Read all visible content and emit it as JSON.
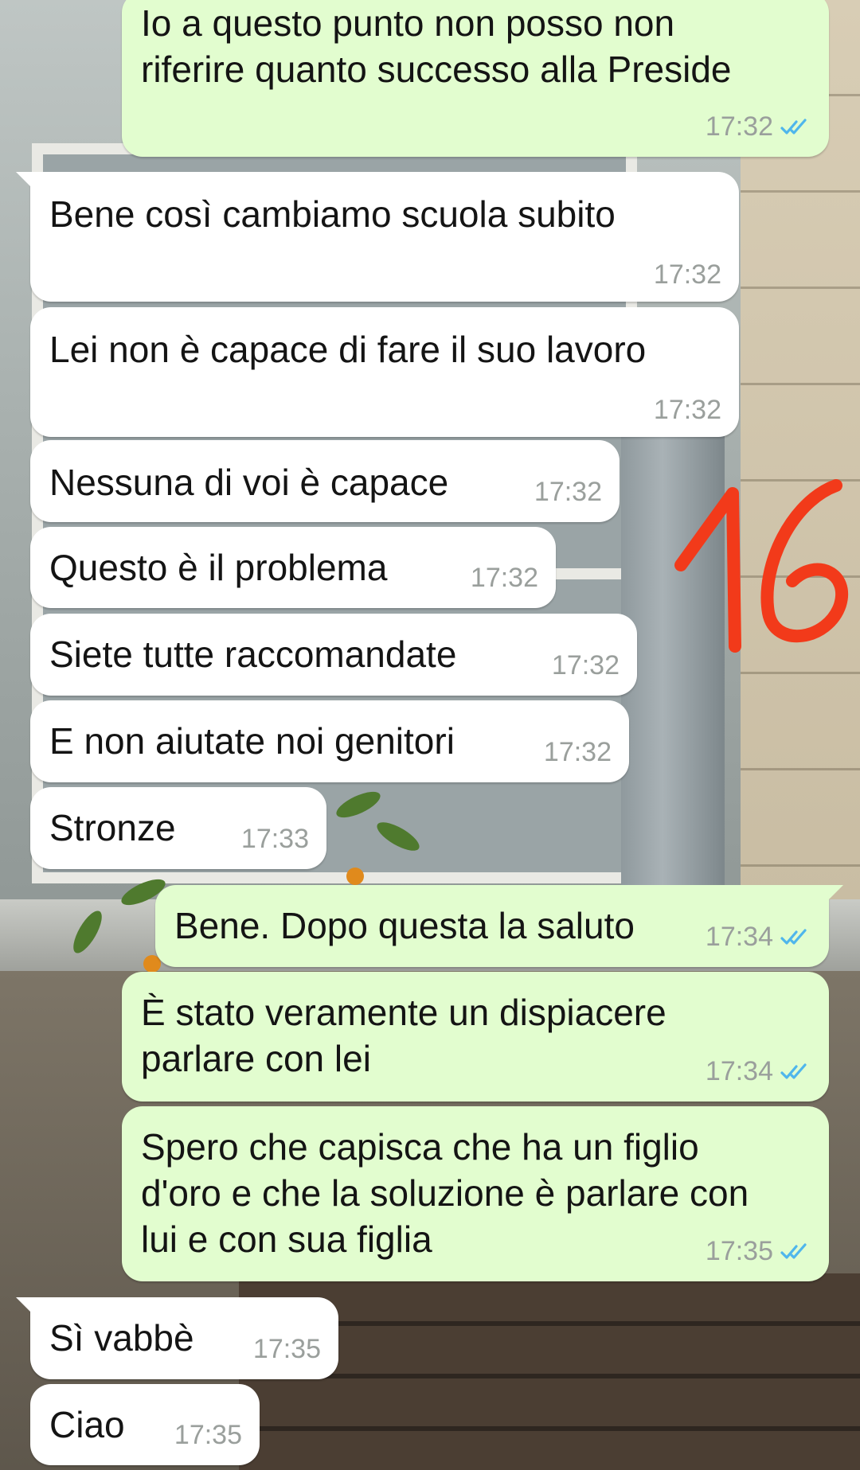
{
  "colors": {
    "incoming_bubble": "#ffffff",
    "outgoing_bubble": "#e2fdcf",
    "timestamp": "#9a9f9c",
    "read_ticks": "#4fb6ec",
    "annotation": "#f23a1a"
  },
  "annotation": {
    "text": "16"
  },
  "messages": [
    {
      "direction": "out",
      "text": "Io a questo punto non posso non\nriferire quanto successo alla Preside",
      "time": "17:32",
      "status": "read-double-tick-icon"
    },
    {
      "direction": "in",
      "text": "Bene così cambiamo scuola subito",
      "time": "17:32"
    },
    {
      "direction": "in",
      "text": "Lei non è capace di fare il suo lavoro",
      "time": "17:32"
    },
    {
      "direction": "in",
      "text": "Nessuna di voi è capace",
      "time": "17:32"
    },
    {
      "direction": "in",
      "text": "Questo è il problema",
      "time": "17:32"
    },
    {
      "direction": "in",
      "text": "Siete tutte raccomandate",
      "time": "17:32"
    },
    {
      "direction": "in",
      "text": "E non aiutate noi genitori",
      "time": "17:32"
    },
    {
      "direction": "in",
      "text": "Stronze",
      "time": "17:33"
    },
    {
      "direction": "out",
      "text": "Bene. Dopo questa la saluto",
      "time": "17:34",
      "status": "read-double-tick-icon"
    },
    {
      "direction": "out",
      "text": "È stato veramente un dispiacere\nparlare con lei",
      "time": "17:34",
      "status": "read-double-tick-icon"
    },
    {
      "direction": "out",
      "text": "Spero che capisca che ha un figlio\nd'oro e che la soluzione è parlare con\nlui e con sua figlia",
      "time": "17:35",
      "status": "read-double-tick-icon"
    },
    {
      "direction": "in",
      "text": "Sì vabbè",
      "time": "17:35"
    },
    {
      "direction": "in",
      "text": "Ciao",
      "time": "17:35"
    }
  ]
}
